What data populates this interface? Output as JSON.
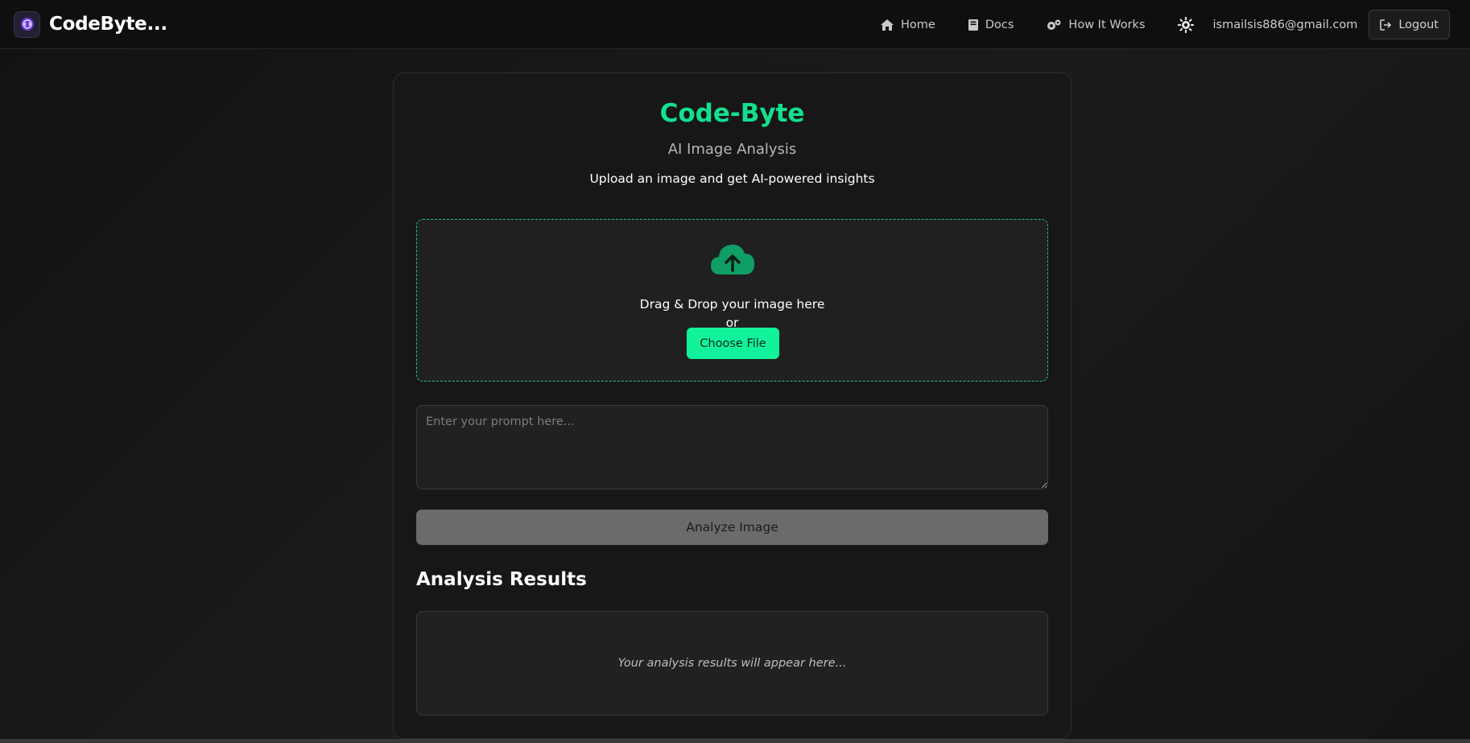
{
  "brand": {
    "name": "CodeByte...",
    "logo_icon": "code-logo-icon",
    "accent": "#7c4dff"
  },
  "nav": {
    "links": [
      {
        "label": "Home",
        "icon": "home-icon"
      },
      {
        "label": "Docs",
        "icon": "book-icon"
      },
      {
        "label": "How It Works",
        "icon": "gears-icon"
      }
    ],
    "theme_icon": "sun-icon",
    "user_email": "ismailsis886@gmail.com",
    "logout_label": "Logout"
  },
  "main": {
    "title": "Code-Byte",
    "subtitle": "AI Image Analysis",
    "tagline": "Upload an image and get AI-powered insights",
    "dropzone": {
      "icon": "cloud-upload-icon",
      "drop_text": "Drag & Drop your image here",
      "or_text": "or",
      "choose_label": "Choose File"
    },
    "prompt": {
      "placeholder": "Enter your prompt here...",
      "value": ""
    },
    "analyze_label": "Analyze Image",
    "results": {
      "heading": "Analysis Results",
      "placeholder": "Your analysis results will appear here..."
    }
  },
  "colors": {
    "accent": "#13e08e",
    "button_green": "#11f29a",
    "background": "#161616",
    "card": "#171717"
  }
}
